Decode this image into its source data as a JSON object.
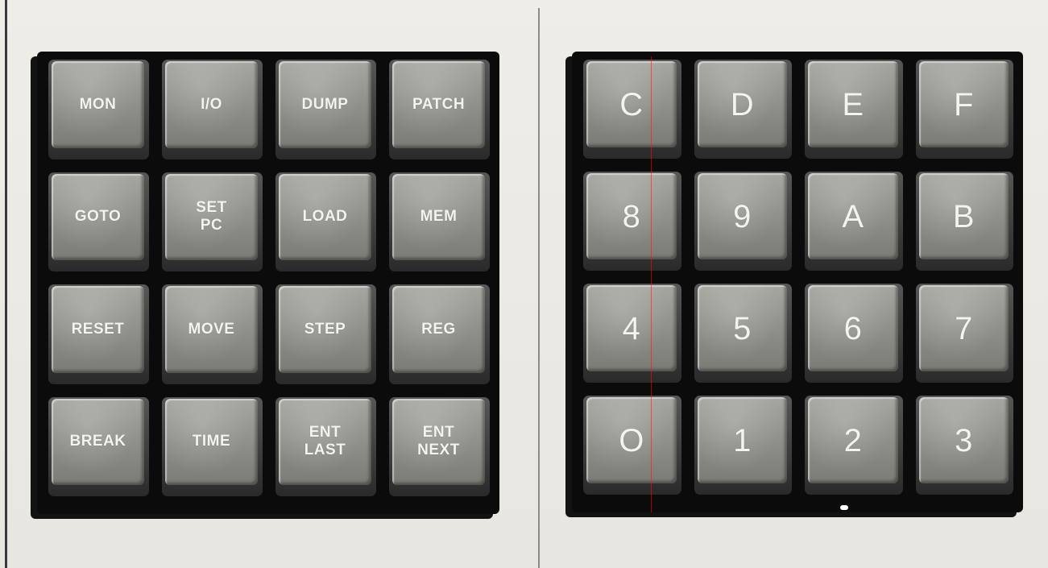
{
  "command_keypad": {
    "keys": [
      {
        "label": "MON"
      },
      {
        "label": "I/O"
      },
      {
        "label": "DUMP"
      },
      {
        "label": "PATCH"
      },
      {
        "label": "GOTO"
      },
      {
        "label": "SET\nPC"
      },
      {
        "label": "LOAD"
      },
      {
        "label": "MEM"
      },
      {
        "label": "RESET"
      },
      {
        "label": "MOVE"
      },
      {
        "label": "STEP"
      },
      {
        "label": "REG"
      },
      {
        "label": "BREAK"
      },
      {
        "label": "TIME"
      },
      {
        "label": "ENT\nLAST"
      },
      {
        "label": "ENT\nNEXT"
      }
    ]
  },
  "hex_keypad": {
    "keys": [
      {
        "label": "C"
      },
      {
        "label": "D"
      },
      {
        "label": "E"
      },
      {
        "label": "F"
      },
      {
        "label": "8"
      },
      {
        "label": "9"
      },
      {
        "label": "A"
      },
      {
        "label": "B"
      },
      {
        "label": "4"
      },
      {
        "label": "5"
      },
      {
        "label": "6"
      },
      {
        "label": "7"
      },
      {
        "label": "O"
      },
      {
        "label": "1"
      },
      {
        "label": "2"
      },
      {
        "label": "3"
      }
    ]
  },
  "colors": {
    "paper": "#eceae4",
    "keypad_frame": "#0b0b0b",
    "keycap": "#9a9a94",
    "key_label": "#f3f3ef"
  }
}
